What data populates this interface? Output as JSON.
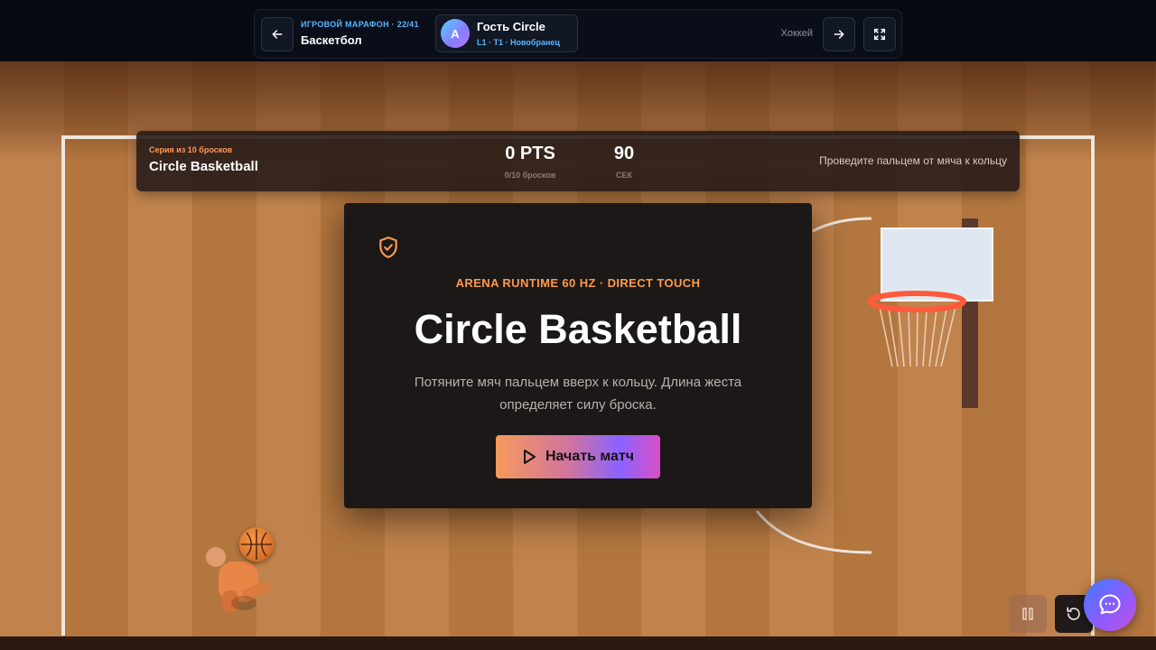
{
  "header": {
    "marathon_label": "ИГРОВОЙ МАРАФОН · 22/41",
    "game_name": "Баскетбол",
    "user": {
      "avatar_letter": "A",
      "name": "Гость Circle",
      "subtitle": "L1 · T1 · Новобранец"
    },
    "next_game_label": "Хоккей",
    "icons": {
      "prev": "arrow-left-icon",
      "next": "arrow-right-icon",
      "fullscreen": "fullscreen-icon"
    }
  },
  "scorebar": {
    "series_label": "Серия из 10 бросков",
    "title": "Circle Basketball",
    "points_value": "0 PTS",
    "points_sub": "0/10 бросков",
    "time_value": "90",
    "time_sub": "СЕК",
    "hint": "Проведите пальцем от мяча к кольцу"
  },
  "modal": {
    "icon": "shield-check-icon",
    "runtime_label": "ARENA RUNTIME 60 HZ · DIRECT TOUCH",
    "title": "Circle Basketball",
    "description": "Потяните мяч пальцем вверх к кольцу. Длина жеста определяет силу броска.",
    "start_button_label": "Начать матч",
    "start_icon": "play-icon"
  },
  "controls": {
    "pause_icon": "pause-icon",
    "restart_icon": "restart-icon",
    "chat_icon": "chat-bubble-icon"
  },
  "colors": {
    "accent_orange": "#ff9a4d",
    "accent_blue": "#56b6ff",
    "court_light": "#c0834d",
    "court_dark": "#b3763f",
    "modal_bg": "#1b1817",
    "rim": "#ff5a3a"
  }
}
